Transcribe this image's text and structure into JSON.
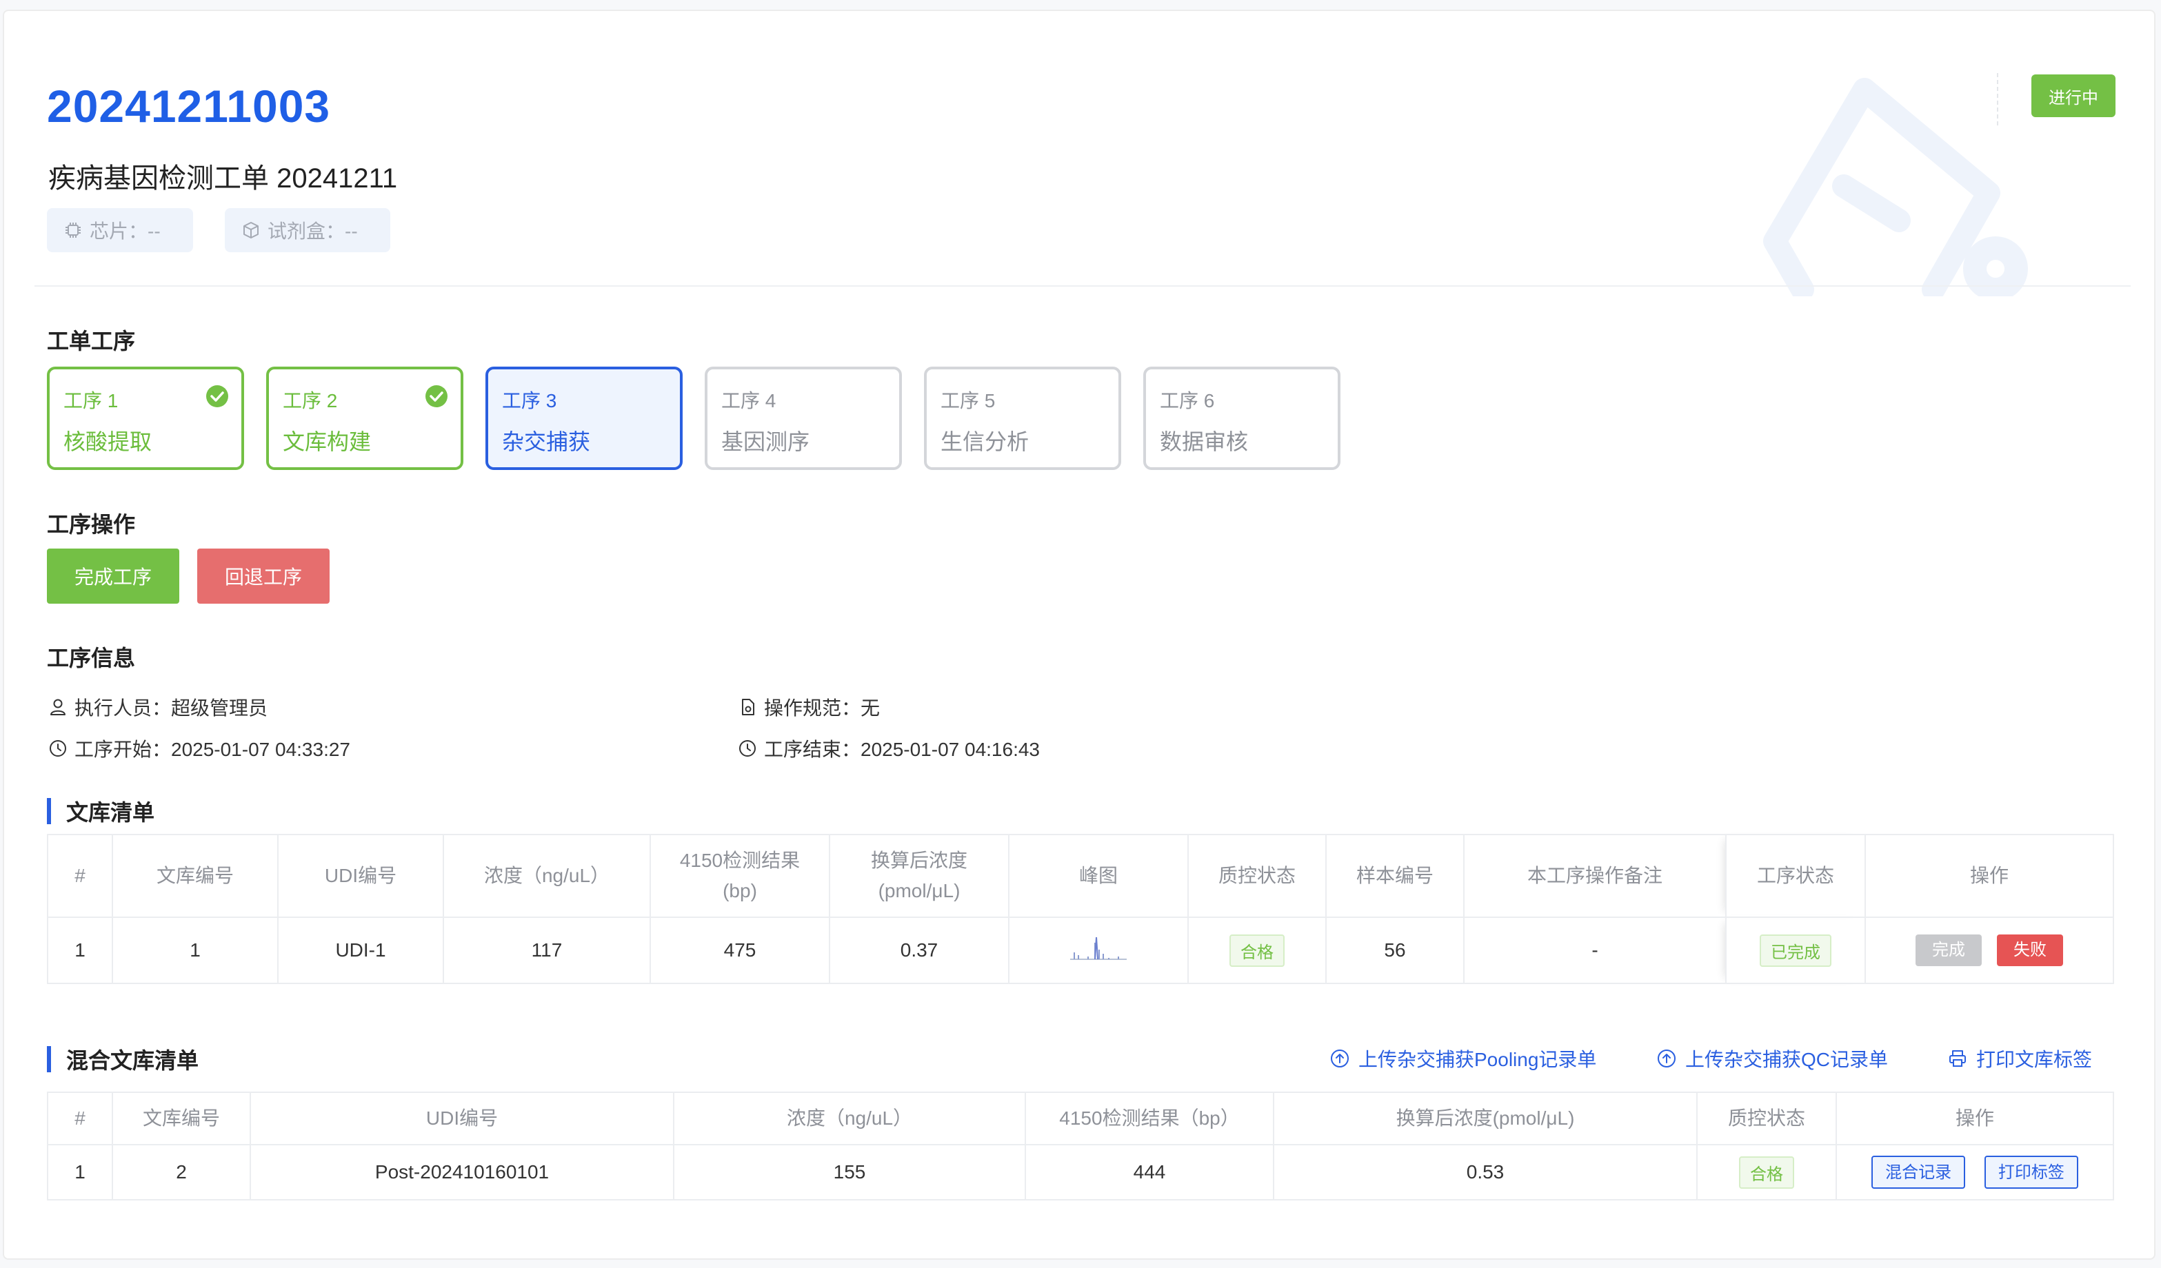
{
  "header": {
    "order_no": "20241211003",
    "order_name": "疾病基因检测工单 20241211",
    "chip_label": "芯片：--",
    "kit_label": "试剂盒：--",
    "status": "进行中"
  },
  "steps_section": {
    "title": "工单工序",
    "steps": [
      {
        "no": "工序 1",
        "name": "核酸提取",
        "state": "done"
      },
      {
        "no": "工序 2",
        "name": "文库构建",
        "state": "done"
      },
      {
        "no": "工序 3",
        "name": "杂交捕获",
        "state": "active"
      },
      {
        "no": "工序 4",
        "name": "基因测序",
        "state": "pending"
      },
      {
        "no": "工序 5",
        "name": "生信分析",
        "state": "pending"
      },
      {
        "no": "工序 6",
        "name": "数据审核",
        "state": "pending"
      }
    ]
  },
  "ops_section": {
    "title": "工序操作",
    "complete_label": "完成工序",
    "rollback_label": "回退工序"
  },
  "info_section": {
    "title": "工序信息",
    "executor": "执行人员：超级管理员",
    "spec": "操作规范：无",
    "start": "工序开始：2025-01-07 04:33:27",
    "end": "工序结束：2025-01-07 04:16:43"
  },
  "library_list": {
    "title": "文库清单",
    "headers": [
      "#",
      "文库编号",
      "UDI编号",
      "浓度（ng/uL）",
      "4150检测结果\n(bp)",
      "换算后浓度\n(pmol/μL)",
      "峰图",
      "质控状态",
      "样本编号",
      "本工序操作备注",
      "工序状态",
      "操作"
    ],
    "rows": [
      {
        "idx": "1",
        "lib_no": "1",
        "udi": "UDI-1",
        "conc": "117",
        "result_4150": "475",
        "conv_conc": "0.37",
        "qc": "合格",
        "sample_no": "56",
        "remark": "-",
        "step_status": "已完成",
        "btn_done": "完成",
        "btn_fail": "失败"
      }
    ]
  },
  "mixed_list": {
    "title": "混合文库清单",
    "upload_pooling": "上传杂交捕获Pooling记录单",
    "upload_qc": "上传杂交捕获QC记录单",
    "print_labels": "打印文库标签",
    "headers": [
      "#",
      "文库编号",
      "UDI编号",
      "浓度（ng/uL）",
      "4150检测结果（bp）",
      "换算后浓度(pmol/μL)",
      "质控状态",
      "操作"
    ],
    "rows": [
      {
        "idx": "1",
        "lib_no": "2",
        "udi": "Post-202410160101",
        "conc": "155",
        "result_4150": "444",
        "conv_conc": "0.53",
        "qc": "合格",
        "btn_mix": "混合记录",
        "btn_print": "打印标签"
      }
    ]
  },
  "colors": {
    "primary": "#2a5fe0",
    "success": "#74c045",
    "danger": "#e66e6e"
  }
}
